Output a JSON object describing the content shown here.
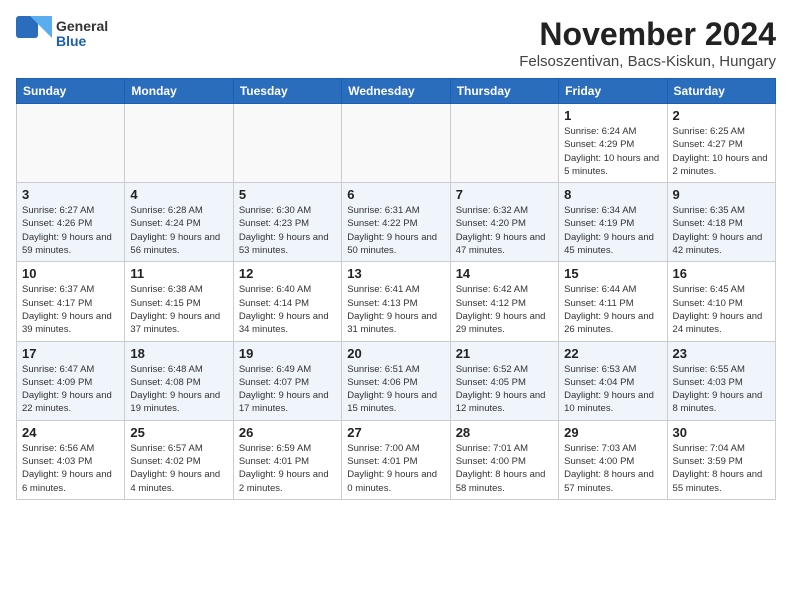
{
  "header": {
    "logo_general": "General",
    "logo_blue": "Blue",
    "title": "November 2024",
    "location": "Felsoszentivan, Bacs-Kiskun, Hungary"
  },
  "weekdays": [
    "Sunday",
    "Monday",
    "Tuesday",
    "Wednesday",
    "Thursday",
    "Friday",
    "Saturday"
  ],
  "weeks": [
    [
      {
        "day": "",
        "info": ""
      },
      {
        "day": "",
        "info": ""
      },
      {
        "day": "",
        "info": ""
      },
      {
        "day": "",
        "info": ""
      },
      {
        "day": "",
        "info": ""
      },
      {
        "day": "1",
        "info": "Sunrise: 6:24 AM\nSunset: 4:29 PM\nDaylight: 10 hours\nand 5 minutes."
      },
      {
        "day": "2",
        "info": "Sunrise: 6:25 AM\nSunset: 4:27 PM\nDaylight: 10 hours\nand 2 minutes."
      }
    ],
    [
      {
        "day": "3",
        "info": "Sunrise: 6:27 AM\nSunset: 4:26 PM\nDaylight: 9 hours\nand 59 minutes."
      },
      {
        "day": "4",
        "info": "Sunrise: 6:28 AM\nSunset: 4:24 PM\nDaylight: 9 hours\nand 56 minutes."
      },
      {
        "day": "5",
        "info": "Sunrise: 6:30 AM\nSunset: 4:23 PM\nDaylight: 9 hours\nand 53 minutes."
      },
      {
        "day": "6",
        "info": "Sunrise: 6:31 AM\nSunset: 4:22 PM\nDaylight: 9 hours\nand 50 minutes."
      },
      {
        "day": "7",
        "info": "Sunrise: 6:32 AM\nSunset: 4:20 PM\nDaylight: 9 hours\nand 47 minutes."
      },
      {
        "day": "8",
        "info": "Sunrise: 6:34 AM\nSunset: 4:19 PM\nDaylight: 9 hours\nand 45 minutes."
      },
      {
        "day": "9",
        "info": "Sunrise: 6:35 AM\nSunset: 4:18 PM\nDaylight: 9 hours\nand 42 minutes."
      }
    ],
    [
      {
        "day": "10",
        "info": "Sunrise: 6:37 AM\nSunset: 4:17 PM\nDaylight: 9 hours\nand 39 minutes."
      },
      {
        "day": "11",
        "info": "Sunrise: 6:38 AM\nSunset: 4:15 PM\nDaylight: 9 hours\nand 37 minutes."
      },
      {
        "day": "12",
        "info": "Sunrise: 6:40 AM\nSunset: 4:14 PM\nDaylight: 9 hours\nand 34 minutes."
      },
      {
        "day": "13",
        "info": "Sunrise: 6:41 AM\nSunset: 4:13 PM\nDaylight: 9 hours\nand 31 minutes."
      },
      {
        "day": "14",
        "info": "Sunrise: 6:42 AM\nSunset: 4:12 PM\nDaylight: 9 hours\nand 29 minutes."
      },
      {
        "day": "15",
        "info": "Sunrise: 6:44 AM\nSunset: 4:11 PM\nDaylight: 9 hours\nand 26 minutes."
      },
      {
        "day": "16",
        "info": "Sunrise: 6:45 AM\nSunset: 4:10 PM\nDaylight: 9 hours\nand 24 minutes."
      }
    ],
    [
      {
        "day": "17",
        "info": "Sunrise: 6:47 AM\nSunset: 4:09 PM\nDaylight: 9 hours\nand 22 minutes."
      },
      {
        "day": "18",
        "info": "Sunrise: 6:48 AM\nSunset: 4:08 PM\nDaylight: 9 hours\nand 19 minutes."
      },
      {
        "day": "19",
        "info": "Sunrise: 6:49 AM\nSunset: 4:07 PM\nDaylight: 9 hours\nand 17 minutes."
      },
      {
        "day": "20",
        "info": "Sunrise: 6:51 AM\nSunset: 4:06 PM\nDaylight: 9 hours\nand 15 minutes."
      },
      {
        "day": "21",
        "info": "Sunrise: 6:52 AM\nSunset: 4:05 PM\nDaylight: 9 hours\nand 12 minutes."
      },
      {
        "day": "22",
        "info": "Sunrise: 6:53 AM\nSunset: 4:04 PM\nDaylight: 9 hours\nand 10 minutes."
      },
      {
        "day": "23",
        "info": "Sunrise: 6:55 AM\nSunset: 4:03 PM\nDaylight: 9 hours\nand 8 minutes."
      }
    ],
    [
      {
        "day": "24",
        "info": "Sunrise: 6:56 AM\nSunset: 4:03 PM\nDaylight: 9 hours\nand 6 minutes."
      },
      {
        "day": "25",
        "info": "Sunrise: 6:57 AM\nSunset: 4:02 PM\nDaylight: 9 hours\nand 4 minutes."
      },
      {
        "day": "26",
        "info": "Sunrise: 6:59 AM\nSunset: 4:01 PM\nDaylight: 9 hours\nand 2 minutes."
      },
      {
        "day": "27",
        "info": "Sunrise: 7:00 AM\nSunset: 4:01 PM\nDaylight: 9 hours\nand 0 minutes."
      },
      {
        "day": "28",
        "info": "Sunrise: 7:01 AM\nSunset: 4:00 PM\nDaylight: 8 hours\nand 58 minutes."
      },
      {
        "day": "29",
        "info": "Sunrise: 7:03 AM\nSunset: 4:00 PM\nDaylight: 8 hours\nand 57 minutes."
      },
      {
        "day": "30",
        "info": "Sunrise: 7:04 AM\nSunset: 3:59 PM\nDaylight: 8 hours\nand 55 minutes."
      }
    ]
  ]
}
